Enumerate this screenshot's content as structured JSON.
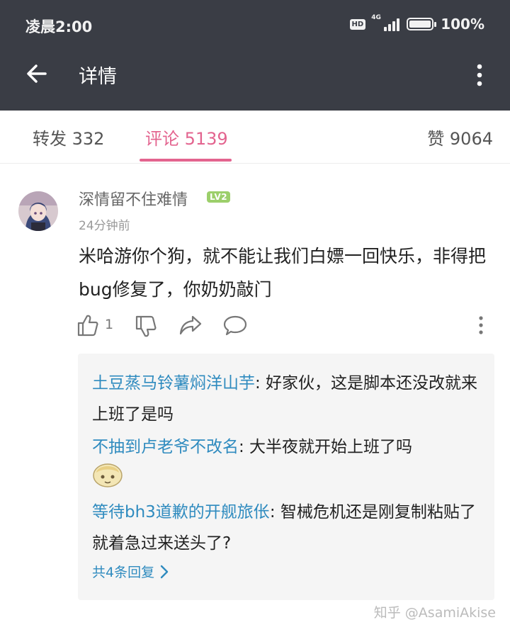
{
  "status_bar": {
    "time": "凌晨2:00",
    "hd": "HD",
    "network": "4G",
    "battery": "100%"
  },
  "toolbar": {
    "title": "详情"
  },
  "tabs": {
    "forward": "转发 332",
    "comments": "评论 5139",
    "likes": "赞 9064"
  },
  "comment": {
    "username": "深情留不住难情",
    "level": "LV2",
    "time": "24分钟前",
    "text": "米哈游你个狗，就不能让我们白嫖一回快乐，非得把bug修复了，你奶奶敲门",
    "like_count": "1"
  },
  "replies": [
    {
      "name": "土豆蒸马铃薯焖洋山芋",
      "text": ": 好家伙，这是脚本还没改就来上班了是吗"
    },
    {
      "name": "不抽到卢老爷不改名",
      "text": ": 大半夜就开始上班了吗"
    },
    {
      "name": "等待bh3道歉的开舰旅伥",
      "text": ": 智械危机还是刚复制粘贴了就着急过来送头了?"
    }
  ],
  "more_replies": "共4条回复",
  "watermark": "知乎 @AsamiAkise",
  "colors": {
    "header_bg": "#3a3d45",
    "accent_pink": "#e3648f",
    "link_blue": "#2f8bbf",
    "reply_bg": "#f5f5f5"
  }
}
